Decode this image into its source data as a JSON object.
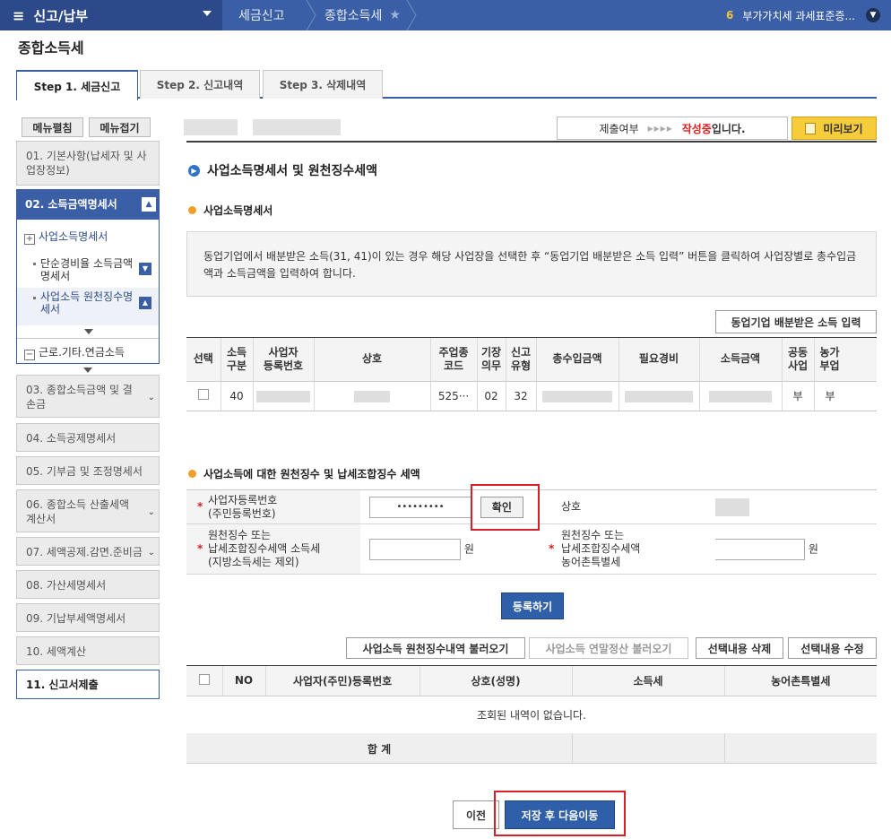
{
  "topbar": {
    "menu_label": "신고/납부",
    "crumbs": [
      "세금신고",
      "종합소득세"
    ],
    "right_num": "6",
    "right_text": "부가가치세 과세표준증..."
  },
  "page_title": "종합소득세",
  "tabs": [
    "Step 1. 세금신고",
    "Step 2. 신고내역",
    "Step 3. 삭제내역"
  ],
  "side": {
    "expand_btn": "메뉴펼침",
    "collapse_btn": "메뉴접기",
    "steps": [
      "01. 기본사항(납세자 및 사업장정보)",
      "02. 소득금액명세서",
      "03. 종합소득금액 및 결손금",
      "04. 소득공제명세서",
      "05. 기부금 및 조정명세서",
      "06. 종합소득 산출세액계산서",
      "07. 세액공제.감면.준비금",
      "08. 가산세명세서",
      "09. 기납부세액명세서",
      "10. 세액계산",
      "11. 신고서제출"
    ],
    "step02_sub": {
      "group": "사업소득명세서",
      "item1": "단순경비율 소득금액명세서",
      "item2": "사업소득 원천징수명세서",
      "group2": "근로.기타.연금소득"
    }
  },
  "status": {
    "label": "제출여부",
    "arrow": "▸▸▸▸",
    "value_red": "작성중",
    "value_rest": "입니다.",
    "preview": "미리보기"
  },
  "section": {
    "title": "사업소득명세서 및 원천징수세액",
    "sub1": "사업소득명세서",
    "notice": "동업기업에서 배분받은 소득(31, 41)이 있는 경우 해당 사업장을 선택한 후 “동업기업 배분받은 소득 입력” 버튼을 클릭하여 사업장별로 총수입금액과 소득금액을 입력하여 합니다.",
    "partner_btn": "동업기업 배분받은 소득 입력"
  },
  "table1": {
    "headers": [
      "선택",
      "소득\n구분",
      "사업자\n등록번호",
      "상호",
      "주업종\n코드",
      "기장\n의무",
      "신고\n유형",
      "총수입금액",
      "필요경비",
      "소득금액",
      "공동\n사업",
      "농가\n부업"
    ],
    "row": {
      "income_type": "40",
      "industry_code": "525···",
      "bookkeeping": "02",
      "report_type": "32",
      "joint": "부",
      "farm": "부"
    }
  },
  "withholding": {
    "sub2": "사업소득에 대한 원천징수 및 납세조합징수 세액",
    "reg_label": "사업자등록번호\n(주민등록번호)",
    "reg_value": "•••••••••",
    "confirm_btn": "확인",
    "name_label": "상호",
    "tax_label": "원천징수 또는\n납세조합징수세액 소득세\n(지방소득세는 제외)",
    "unit": "원",
    "rural_label": "원천징수 또는\n납세조합징수세액\n농어촌특별세",
    "register_btn": "등록하기"
  },
  "actions": [
    "사업소득 원천징수내역 불러오기",
    "사업소득 연말정산 불러오기",
    "선택내용 삭제",
    "선택내용 수정"
  ],
  "table2": {
    "headers": [
      "",
      "NO",
      "사업자(주민)등록번호",
      "상호(성명)",
      "소득세",
      "농어촌특별세"
    ],
    "empty": "조회된 내역이 없습니다.",
    "total": "합 계"
  },
  "footer": {
    "prev": "이전",
    "save_next": "저장 후 다음이동"
  }
}
